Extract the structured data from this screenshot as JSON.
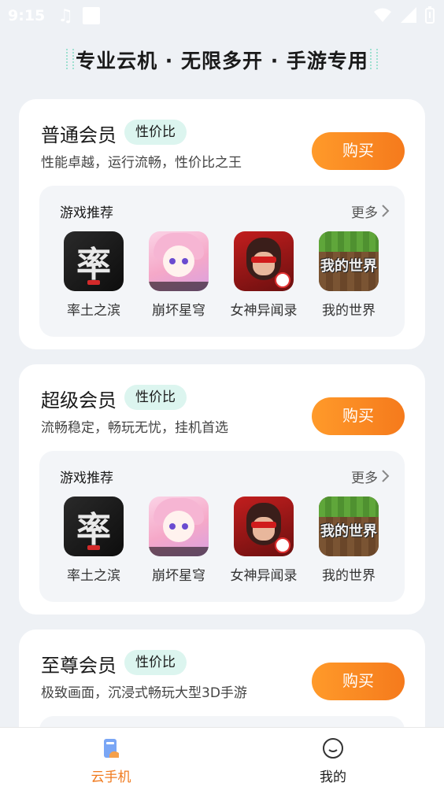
{
  "status_bar": {
    "time": "9:15"
  },
  "slogan": "专业云机 · 无限多开 · 手游专用",
  "plans": [
    {
      "title": "普通会员",
      "badge": "性价比",
      "desc": "性能卓越，运行流畅，性价比之王",
      "buy_label": "购买",
      "games_title": "游戏推荐",
      "more_label": "更多",
      "games": [
        {
          "name": "率土之滨",
          "icon": "shuaitu-zhibin-icon"
        },
        {
          "name": "崩坏星穹",
          "icon": "honkai-star-rail-icon"
        },
        {
          "name": "女神异闻录",
          "icon": "persona-icon"
        },
        {
          "name": "我的世界",
          "icon": "minecraft-icon"
        }
      ]
    },
    {
      "title": "超级会员",
      "badge": "性价比",
      "desc": "流畅稳定，畅玩无忧，挂机首选",
      "buy_label": "购买",
      "games_title": "游戏推荐",
      "more_label": "更多",
      "games": [
        {
          "name": "率土之滨",
          "icon": "shuaitu-zhibin-icon"
        },
        {
          "name": "崩坏星穹",
          "icon": "honkai-star-rail-icon"
        },
        {
          "name": "女神异闻录",
          "icon": "persona-icon"
        },
        {
          "name": "我的世界",
          "icon": "minecraft-icon"
        }
      ]
    },
    {
      "title": "至尊会员",
      "badge": "性价比",
      "desc": "极致画面，沉浸式畅玩大型3D手游",
      "buy_label": "购买"
    }
  ],
  "bottom_nav": {
    "items": [
      {
        "label": "云手机",
        "icon": "cloud-phone-icon",
        "active": true
      },
      {
        "label": "我的",
        "icon": "profile-face-icon",
        "active": false
      }
    ]
  },
  "colors": {
    "accent": "#f07a1e",
    "badge_bg": "#dcf5ef",
    "page_bg": "#eef1f5"
  }
}
